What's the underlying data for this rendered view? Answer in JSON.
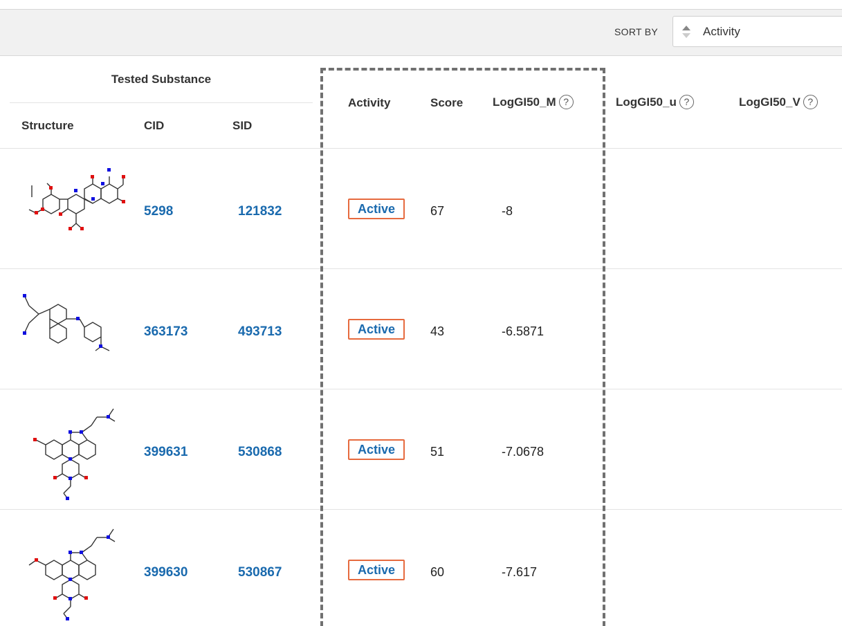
{
  "toolbar": {
    "sort_label": "SORT BY",
    "sort_value": "Activity"
  },
  "table": {
    "group_header": "Tested Substance",
    "columns": {
      "structure": "Structure",
      "cid": "CID",
      "sid": "SID",
      "activity": "Activity",
      "score": "Score",
      "loggi50_m": "LogGI50_M",
      "loggi50_u": "LogGI50_u",
      "loggi50_v": "LogGI50_V"
    },
    "help_glyph": "?",
    "rows": [
      {
        "cid": "5298",
        "sid": "121832",
        "activity": "Active",
        "score": "67",
        "loggi50_m": "-8"
      },
      {
        "cid": "363173",
        "sid": "493713",
        "activity": "Active",
        "score": "43",
        "loggi50_m": "-6.5871"
      },
      {
        "cid": "399631",
        "sid": "530868",
        "activity": "Active",
        "score": "51",
        "loggi50_m": "-7.0678"
      },
      {
        "cid": "399630",
        "sid": "530867",
        "activity": "Active",
        "score": "60",
        "loggi50_m": "-7.617"
      }
    ]
  },
  "colors": {
    "link": "#1a6aae",
    "active_border": "#e66a3e",
    "atom_oxygen": "#e01010",
    "atom_nitrogen": "#1010e0",
    "bond": "#333333"
  },
  "icons": [
    "sort-arrows-icon",
    "help-circle-icon",
    "molecule-structure-icon"
  ]
}
